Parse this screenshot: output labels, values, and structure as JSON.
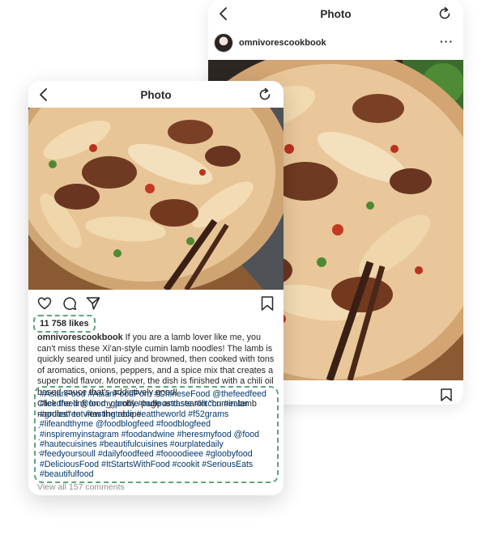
{
  "back_post": {
    "header_title": "Photo",
    "username": "omnivorescookbook",
    "more_label": "···"
  },
  "front_post": {
    "header_title": "Photo",
    "likes": "11 758 likes",
    "caption_username": "omnivorescookbook",
    "caption_text": " If you are a lamb lover like me, you can't miss these Xi'an-style cumin lamb noodles! The lamb is quickly seared until juicy and browned, then cooked with tons of aromatics, onions, peppers, and a spice mix that creates a super bold flavor. Moreover, the dish is finished with a chili oil based sauce that's addictively good!",
    "caption_cta": "Click the link on my profile page and search \"cumin lamb noodles\" to view the recipe.",
    "dots": [
      ".",
      ".",
      ".",
      "."
    ],
    "hashtags": "#AsianFood #AsianFoodPorn #ChineseFood @thefeedfeed #feedfeed @food_glooby #huffposttaste #kitchn #eater #grubstreet #tastingtable #eattheworld #f52grams #lifeandthyme @foodblogfeed #foodblogfeed #inspiremyinstagram #foodandwine #heresmyfood @food #hautecuisines #beautifulcuisines #ourplatedaily #feedyoursoull #dailyfoodfeed #foooodieee #gloobyfood #DeliciousFood #ItStartsWithFood #cookit #SeriousEats #beautifulfood",
    "view_all_comments": "View all 157 comments"
  },
  "colors": {
    "highlight_dash": "#5ea67e",
    "hashtag_text": "#00376b",
    "muted_text": "#8e8e8e"
  }
}
